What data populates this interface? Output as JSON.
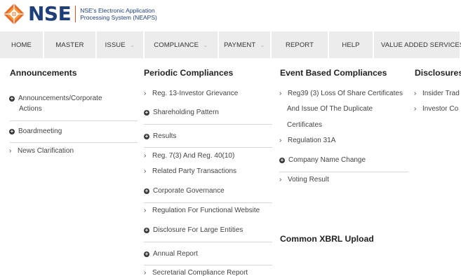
{
  "header": {
    "brand": "NSE",
    "subtitle_line1": "NSE's Electronic Application",
    "subtitle_line2": "Processing System (NEAPS)",
    "colors": {
      "brand_blue": "#1f3f7a",
      "brand_orange": "#e8692c"
    }
  },
  "nav": [
    {
      "label": "HOME",
      "dropdown": false
    },
    {
      "label": "MASTER",
      "dropdown": false
    },
    {
      "label": "ISSUE",
      "dropdown": true
    },
    {
      "label": "COMPLIANCE",
      "dropdown": true
    },
    {
      "label": "PAYMENT",
      "dropdown": true
    },
    {
      "label": "REPORT",
      "dropdown": false
    },
    {
      "label": "HELP",
      "dropdown": false
    },
    {
      "label": "VALUE ADDED SERVICES",
      "dropdown": false
    }
  ],
  "announcements": {
    "title": "Announcements",
    "items": [
      "Announcements/Corporate",
      "Actions",
      "Boardmeeting",
      "News Clarification"
    ]
  },
  "periodic": {
    "title": "Periodic Compliances",
    "items": [
      "Reg. 13-Investor Grievance",
      "Shareholding Pattern",
      "Results",
      "Reg. 7(3) And Reg. 40(10)",
      "Related Party Transactions",
      "Corporate Governance",
      "Regulation For Functional Website",
      "Disclosure For Large Entities",
      "Annual Report",
      "Secretarial Compliance Report"
    ]
  },
  "event": {
    "title": "Event Based Compliances",
    "items": [
      "Reg39 (3) Loss Of Share Certificates",
      "And Issue Of The Duplicate",
      "Certificates",
      "Regulation 31A",
      "Company Name Change",
      "Voting Result"
    ]
  },
  "xbrl": {
    "title": "Common XBRL Upload"
  },
  "disclosures": {
    "title": "Disclosures",
    "items": [
      "Insider Trad",
      "Investor Co"
    ]
  }
}
